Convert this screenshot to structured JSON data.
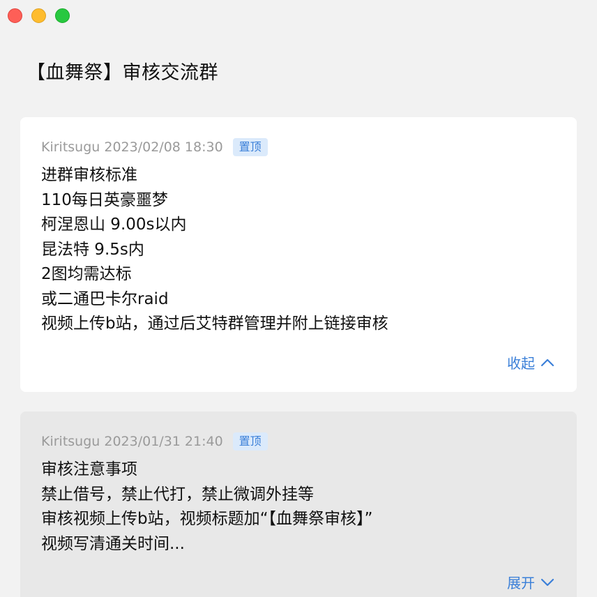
{
  "window": {
    "title": "【血舞祭】审核交流群"
  },
  "announcements": [
    {
      "author_time": "Kiritsugu 2023/02/08 18:30",
      "badge": "置顶",
      "lines": [
        "进群审核标准",
        "110每日英豪噩梦",
        "柯涅恩山 9.00s以内",
        "昆法特 9.5s内",
        "2图均需达标",
        "或二通巴卡尔raid",
        "视频上传b站，通过后艾特群管理并附上链接审核"
      ],
      "toggle_label": "收起",
      "toggle_icon": "chevron-up-icon"
    },
    {
      "author_time": "Kiritsugu 2023/01/31 21:40",
      "badge": "置顶",
      "lines": [
        "审核注意事项",
        "禁止借号，禁止代打，禁止微调外挂等",
        "审核视频上传b站，视频标题加“【血舞祭审核】”",
        "视频写清通关时间..."
      ],
      "toggle_label": "展开",
      "toggle_icon": "chevron-down-icon"
    }
  ],
  "colors": {
    "accent": "#3a7fd8",
    "badge_bg": "#dbeafb",
    "close": "#fe5f57",
    "minimize": "#febc2e",
    "zoom": "#28c840"
  }
}
